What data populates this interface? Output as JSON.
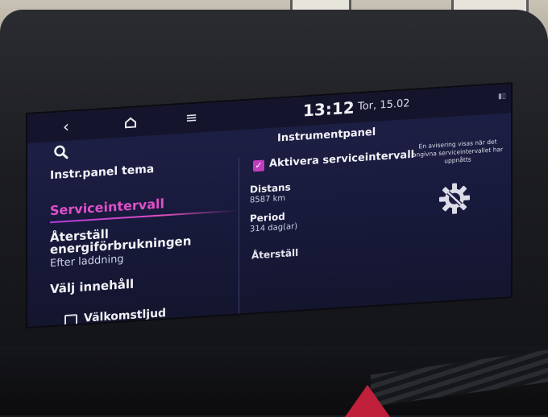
{
  "status_bar": {
    "back_icon": "back-icon",
    "home_icon": "home-icon",
    "menu_icon": "menu-icon",
    "time": "13:12",
    "date": "Tor, 15.02"
  },
  "header": {
    "title": "Instrumentpanel",
    "search_icon": "search-icon"
  },
  "sidebar": {
    "items": [
      {
        "label": "Instr.panel tema"
      },
      {
        "label": "Serviceintervall",
        "selected": true
      },
      {
        "label": "Återställ energiförbrukningen",
        "sub": "Efter laddning"
      },
      {
        "label": "Välj innehåll"
      },
      {
        "label": "Välkomstljud",
        "checked": false
      }
    ]
  },
  "main": {
    "enable_checkbox": {
      "label": "Aktivera serviceintervall",
      "checked": true
    },
    "info_text": "En avisering visas när det angivna serviceintervallet har uppnåtts",
    "distance": {
      "label": "Distans",
      "value": "8587 km"
    },
    "period": {
      "label": "Period",
      "value": "314 dag(ar)"
    },
    "reset_label": "Återställ",
    "service_icon": "service-gear-wrench-icon"
  },
  "colors": {
    "accent": "#e04fc9",
    "screen_bg": "#1b1c40",
    "text": "#f1f1f6"
  }
}
